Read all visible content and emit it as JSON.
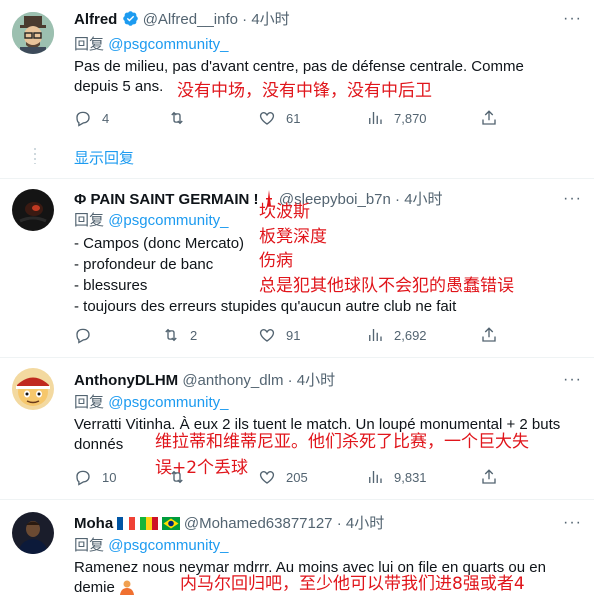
{
  "tweets": [
    {
      "name": "Alfred",
      "handle": "@Alfred__info",
      "time": "4小时",
      "reply_label": "回复",
      "reply_to": "@psgcommunity_",
      "text": [
        "Pas de milieu, pas d'avant centre, pas de défense centrale. Comme",
        "depuis 5 ans."
      ],
      "annotation": [
        "没有中场，没有中锋，没有中后卫"
      ],
      "replies": "4",
      "retweets": "",
      "likes": "61",
      "views": "7,870",
      "show_replies": "显示回复"
    },
    {
      "name": "Φ PAIN SAINT GERMAIN !",
      "handle": "@sleepyboi_b7n",
      "time": "4小时",
      "reply_label": "回复",
      "reply_to": "@psgcommunity_",
      "text": [
        "- Campos (donc Mercato)",
        "- profondeur de banc",
        "- blessures",
        "- toujours des erreurs stupides qu'aucun autre club ne fait"
      ],
      "annotation": [
        "坎波斯",
        "板凳深度",
        "伤病",
        "总是犯其他球队不会犯的愚蠢错误"
      ],
      "replies": "",
      "retweets": "2",
      "likes": "91",
      "views": "2,692"
    },
    {
      "name": "AnthonyDLHM",
      "handle": "@anthony_dlm",
      "time": "4小时",
      "reply_label": "回复",
      "reply_to": "@psgcommunity_",
      "text": [
        "Verratti Vitinha. À eux 2 ils tuent le match. Un loupé monumental + 2 buts",
        "donnés"
      ],
      "annotation": [
        "维拉蒂和维蒂尼亚。他们杀死了比赛，一个巨大失",
        "误+2个丢球"
      ],
      "replies": "10",
      "retweets": "",
      "likes": "205",
      "views": "9,831"
    },
    {
      "name": "Moha",
      "handle": "@Mohamed63877127",
      "time": "4小时",
      "reply_label": "回复",
      "reply_to": "@psgcommunity_",
      "text": [
        "Ramenez nous neymar mdrrr. Au moins avec lui on file en quarts ou en",
        "demie"
      ],
      "annotation": [
        "内马尔回归吧，至少他可以带我们进8强或者4"
      ]
    }
  ],
  "more_icon": "···",
  "colors": {
    "accent": "#1d9bf0",
    "annotation": "#e0151b",
    "muted": "#536471"
  }
}
